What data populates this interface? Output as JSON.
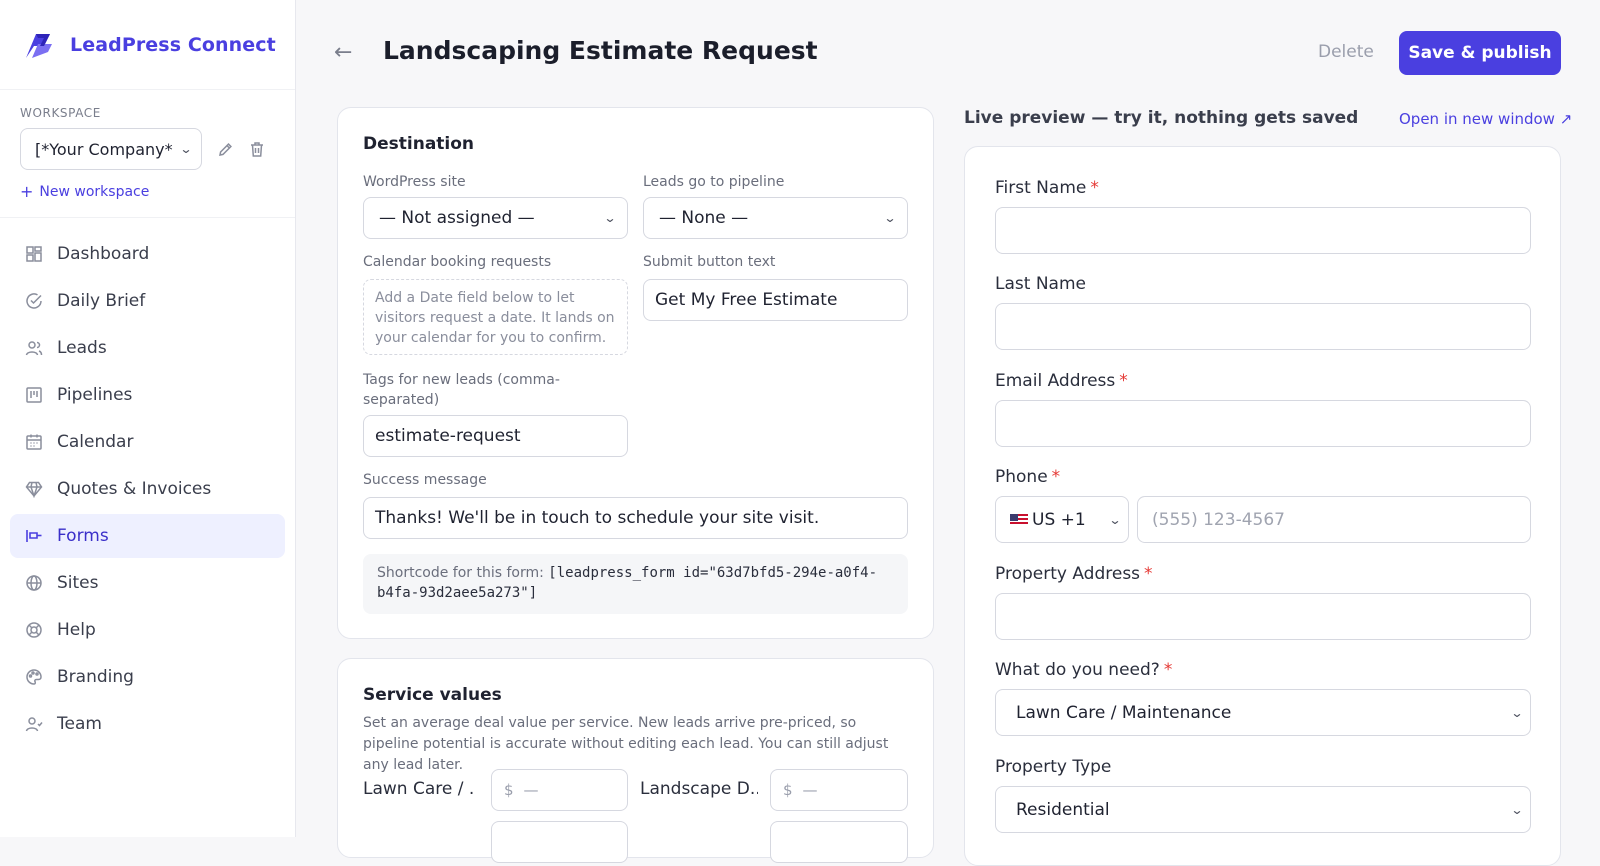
{
  "brand": {
    "name": "LeadPress Connect"
  },
  "workspace": {
    "label": "WORKSPACE",
    "selected": "[*Your Company*",
    "new_label": "New workspace"
  },
  "nav": [
    {
      "label": "Dashboard",
      "icon": "dashboard-icon"
    },
    {
      "label": "Daily Brief",
      "icon": "check-circle-icon"
    },
    {
      "label": "Leads",
      "icon": "users-icon"
    },
    {
      "label": "Pipelines",
      "icon": "kanban-icon"
    },
    {
      "label": "Calendar",
      "icon": "calendar-icon"
    },
    {
      "label": "Quotes & Invoices",
      "icon": "diamond-icon"
    },
    {
      "label": "Forms",
      "icon": "forms-icon",
      "active": true
    },
    {
      "label": "Sites",
      "icon": "globe-icon"
    },
    {
      "label": "Help",
      "icon": "lifebuoy-icon"
    },
    {
      "label": "Branding",
      "icon": "palette-icon"
    },
    {
      "label": "Team",
      "icon": "team-icon"
    }
  ],
  "header": {
    "back": "←",
    "title": "Landscaping Estimate Request",
    "delete_label": "Delete",
    "publish_label": "Save & publish"
  },
  "destination": {
    "title": "Destination",
    "wp_site_label": "WordPress site",
    "wp_site_value": "— Not assigned —",
    "pipeline_label": "Leads go to pipeline",
    "pipeline_value": "— None —",
    "calendar_label": "Calendar booking requests",
    "calendar_hint": "Add a Date field below to let visitors request a date. It lands on your calendar for you to confirm.",
    "submit_label": "Submit button text",
    "submit_value": "Get My Free Estimate",
    "tags_label": "Tags for new leads (comma-separated)",
    "tags_value": "estimate-request",
    "success_label": "Success message",
    "success_value": "Thanks! We'll be in touch to schedule your site visit.",
    "shortcode_prefix": "Shortcode for this form:",
    "shortcode_value": "[leadpress_form id=\"63d7bfd5-294e-a0f4-b4fa-93d2aee5a273\"]"
  },
  "service_values": {
    "title": "Service values",
    "description": "Set an average deal value per service. New leads arrive pre-priced, so pipeline potential is accurate without editing each lead. You can still adjust any lead later.",
    "currency": "$",
    "empty": "—",
    "items": [
      {
        "label": "Lawn Care / ..."
      },
      {
        "label": "Landscape D..."
      }
    ]
  },
  "preview": {
    "heading": "Live preview — try it, nothing gets saved",
    "open_label": "Open in new window ↗",
    "required_mark": "*",
    "first_name": "First Name",
    "last_name": "Last Name",
    "email": "Email Address",
    "phone": "Phone",
    "phone_country": "US +1",
    "phone_placeholder": "(555) 123-4567",
    "address": "Property Address",
    "need_label": "What do you need?",
    "need_value": "Lawn Care / Maintenance",
    "type_label": "Property Type",
    "type_value": "Residential"
  },
  "colors": {
    "accent": "#4a3fe0",
    "required": "#e53935",
    "active_bg": "#eef0ff"
  }
}
